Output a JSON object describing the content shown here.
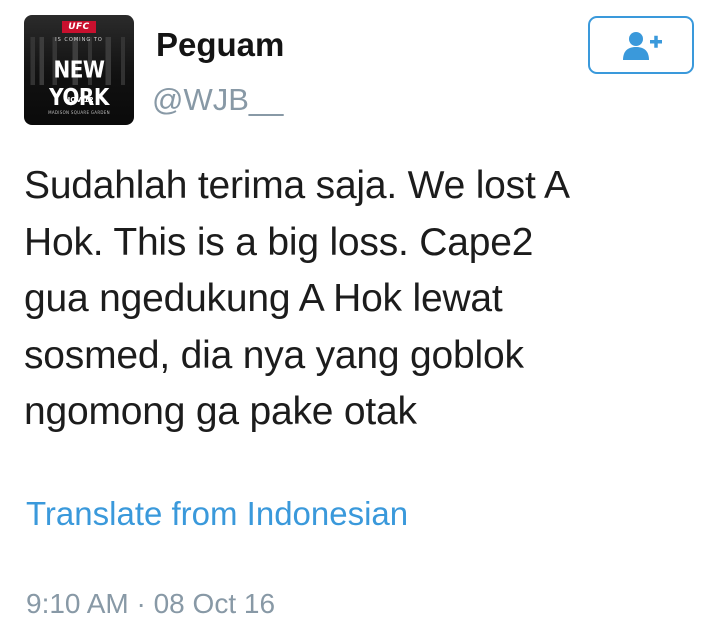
{
  "avatar": {
    "logo_text": "UFC",
    "subtitle": "IS COMING TO",
    "headline": "NEW YORK",
    "date": "NOV 12",
    "venue": "MADISON SQUARE GARDEN"
  },
  "user": {
    "display_name": "Peguam",
    "handle": "@WJB__"
  },
  "follow_button": {
    "icon": "add-user-icon",
    "color": "#3a99db"
  },
  "tweet": {
    "lines": [
      "Sudahlah terima saja. We lost A",
      "Hok. This is a big loss. Cape2",
      "gua ngedukung A Hok lewat",
      "sosmed, dia nya yang goblok",
      "ngomong ga pake otak"
    ],
    "translate_label": "Translate from Indonesian",
    "timestamp": "9:10 AM · 08 Oct 16"
  },
  "colors": {
    "link": "#3a99db",
    "secondary_text": "#8899a6",
    "primary_text": "#1c1c1c"
  }
}
